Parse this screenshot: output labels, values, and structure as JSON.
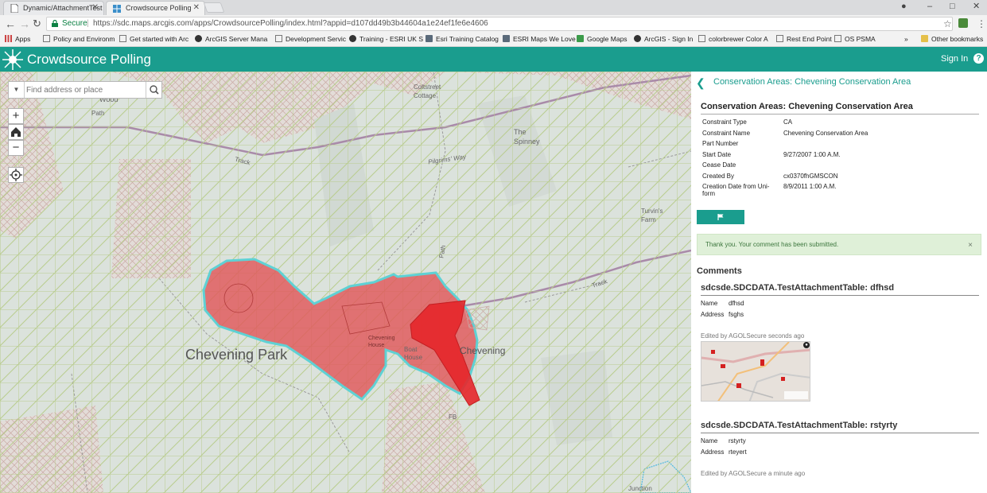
{
  "browser": {
    "tabs": [
      {
        "title": "Dynamic/AttachmentTest",
        "active": false
      },
      {
        "title": "Crowdsource Polling",
        "active": true
      }
    ],
    "secure_label": "Secure",
    "url": "https://sdc.maps.arcgis.com/apps/CrowdsourcePolling/index.html?appid=d107dd49b3b44604a1e24ef1fe6e4606",
    "bookmarks": [
      {
        "label": "Apps",
        "icon": "apps-grid-icon"
      },
      {
        "label": "Policy and Environm",
        "icon": "page-icon"
      },
      {
        "label": "Get started with Arc",
        "icon": "page-icon"
      },
      {
        "label": "ArcGIS Server Mana",
        "icon": "globe-icon"
      },
      {
        "label": "Development Servic",
        "icon": "page-icon"
      },
      {
        "label": "Training - ESRI UK S",
        "icon": "globe-icon"
      },
      {
        "label": "Esri Training Catalog",
        "icon": "esri-icon"
      },
      {
        "label": "ESRI Maps We Love",
        "icon": "esri-icon"
      },
      {
        "label": "Google Maps",
        "icon": "google-maps-icon"
      },
      {
        "label": "ArcGIS - Sign In",
        "icon": "globe-icon"
      },
      {
        "label": "colorbrewer Color A",
        "icon": "page-icon"
      },
      {
        "label": "Rest End Point",
        "icon": "page-icon"
      },
      {
        "label": "OS PSMA",
        "icon": "page-icon"
      }
    ],
    "more_bookmarks": "»",
    "other_bookmarks": "Other bookmarks"
  },
  "app": {
    "title": "Crowdsource Polling",
    "sign_in": "Sign In",
    "help": "?",
    "accent": "#1a9d8e"
  },
  "map": {
    "search_placeholder": "Find address or place",
    "zoom_in": "+",
    "zoom_out": "−",
    "labels": {
      "park": "Chevening Park",
      "chevening": "Chevening",
      "spinney": "The Spinney",
      "wood": "Wood",
      "cottage": "Coltstreet Cottage",
      "turvins": "Turvin's Farm",
      "pilgrims": "Pilgrims' Way",
      "track": "Track",
      "path": "Path",
      "house": "Chevening House",
      "boat_house": "Boat House",
      "fb": "FB",
      "junction": "Junction"
    }
  },
  "panel": {
    "breadcrumb": "Conservation Areas: Chevening Conservation Area",
    "feature_title": "Conservation Areas: Chevening Conservation Area",
    "attributes": [
      {
        "key": "Constraint Type",
        "value": "CA"
      },
      {
        "key": "Constraint Name",
        "value": "Chevening Conservation Area"
      },
      {
        "key": "Part Number",
        "value": ""
      },
      {
        "key": "Start Date",
        "value": "9/27/2007 1:00 A.M."
      },
      {
        "key": "Cease Date",
        "value": ""
      },
      {
        "key": "Created By",
        "value": "cx0370fhGMSCON"
      },
      {
        "key": "Creation Date from Uni-form",
        "value": "8/9/2011 1:00 A.M."
      }
    ],
    "alert": "Thank you. Your comment has been submitted.",
    "alert_close": "×",
    "comments_heading": "Comments",
    "comments": [
      {
        "title": "sdcsde.SDCDATA.TestAttachmentTable: dfhsd",
        "name_label": "Name",
        "name": "dfhsd",
        "address_label": "Address",
        "address": "fsghs",
        "edited": "Edited by AGOLSecure seconds ago"
      },
      {
        "title": "sdcsde.SDCDATA.TestAttachmentTable: rstyrty",
        "name_label": "Name",
        "name": "rstyrty",
        "address_label": "Address",
        "address": "rteyert",
        "edited": "Edited by AGOLSecure a minute ago"
      }
    ]
  }
}
